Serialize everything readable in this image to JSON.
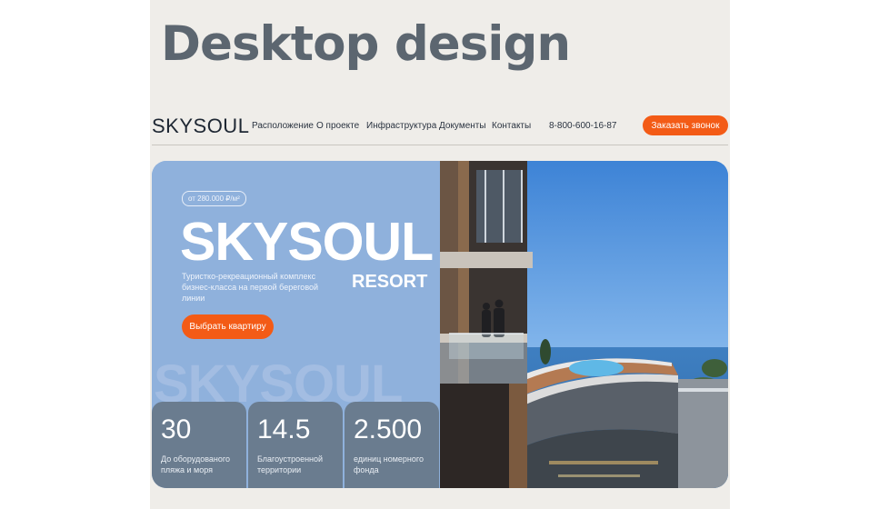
{
  "heading": "Desktop design",
  "header": {
    "logo": "SKYSOUL",
    "nav": [
      "Расположение",
      "О проекте",
      "Инфраструктура",
      "Документы",
      "Контакты"
    ],
    "phone": "8-800-600-16-87",
    "call_button": "Заказать звонок"
  },
  "hero": {
    "price_badge": "от 280.000 ₽/м²",
    "title": "SKYSOUL",
    "subtitle": "RESORT",
    "description": "Туристко-рекреационный комплекс бизнес-класса на первой береговой линии",
    "cta": "Выбрать квартиру",
    "watermark": "SKYSOUL",
    "stats": [
      {
        "value": "30",
        "label": "До оборудованого пляжа и моря"
      },
      {
        "value": "14.5",
        "label": "Благоустроенной территории"
      },
      {
        "value": "2.500",
        "label": "единиц номерного фонда"
      }
    ]
  },
  "colors": {
    "accent": "#f35b16",
    "hero_blue": "#8fb1dc",
    "stat_card": "#6a7c8f",
    "text_dark": "#1e2733"
  }
}
